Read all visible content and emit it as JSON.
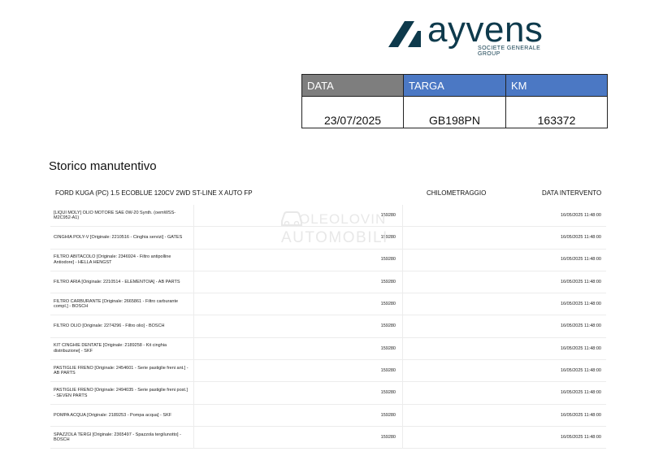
{
  "brand": {
    "name": "ayvens",
    "tagline": "SOCIETE GENERALE GROUP",
    "color": "#0e3a4c"
  },
  "info_table": {
    "headers": [
      "DATA",
      "TARGA",
      "KM"
    ],
    "values": [
      "23/07/2025",
      "GB198PN",
      "163372"
    ],
    "header_colors": [
      "#7e7e7e",
      "#4b78c4",
      "#4b78c4"
    ]
  },
  "section": {
    "title": "Storico manutentivo",
    "vehicle": "FORD KUGA (PC) 1.5 ECOBLUE 120CV 2WD ST-LINE X AUTO FP",
    "col_km": "CHILOMETRAGGIO",
    "col_date": "DATA INTERVENTO"
  },
  "watermark": {
    "line1": "OLEOLOVIN",
    "line2": "AUTOMOBILI"
  },
  "items": [
    {
      "desc": "[LIQUI MOLY] OLIO MOTORE SAE 0W-20 Synth. (oemWSS-M2C952-A1)",
      "km": "159280",
      "date": "16/05/2025 11:48:00"
    },
    {
      "desc": "CINGHIA POLY-V [Originale: 2210516 - Cinghia servizi] - GATES",
      "km": "159280",
      "date": "16/05/2025 11:48:00"
    },
    {
      "desc": "FILTRO ABITACOLO [Originale: 2346924 - Filtro antipolline Antiodore] - HELLA HENGST",
      "km": "159280",
      "date": "16/05/2025 11:48:00"
    },
    {
      "desc": "FILTRO ARIA [Originale: 2210514 - ELEMENTOIA] - AB PARTS",
      "km": "159280",
      "date": "16/05/2025 11:48:00"
    },
    {
      "desc": "FILTRO CARBURANTE [Originale: 2665861 - Filtro carburante compl.] - BOSCH",
      "km": "159280",
      "date": "16/05/2025 11:48:00"
    },
    {
      "desc": "FILTRO OLIO [Originale: 2274296 - Filtro olio] - BOSCH",
      "km": "159280",
      "date": "16/05/2025 11:48:00"
    },
    {
      "desc": "KIT CINGHIE DENTATE [Originale: 2189258 - Kit cinghia distribuzione] - SKF",
      "km": "159280",
      "date": "16/05/2025 11:48:00"
    },
    {
      "desc": "PASTIGLIE FRENO [Originale: 2454601 - Serie pastiglie freni ant.] - AB PARTS",
      "km": "159280",
      "date": "16/05/2025 11:48:00"
    },
    {
      "desc": "PASTIGLIE FRENO [Originale: 2494035 - Serie pastiglie freni post.] - SEVEN PARTS",
      "km": "159280",
      "date": "16/05/2025 11:48:00"
    },
    {
      "desc": "POMPA ACQUA [Originale: 2189253 - Pompa acqua] - SKF",
      "km": "159280",
      "date": "16/05/2025 11:48:00"
    },
    {
      "desc": "SPAZZOLA TERGI [Originale: 2365497 - Spazzola tergilunotto] - BOSCH",
      "km": "159280",
      "date": "16/05/2025 11:48:00"
    }
  ]
}
